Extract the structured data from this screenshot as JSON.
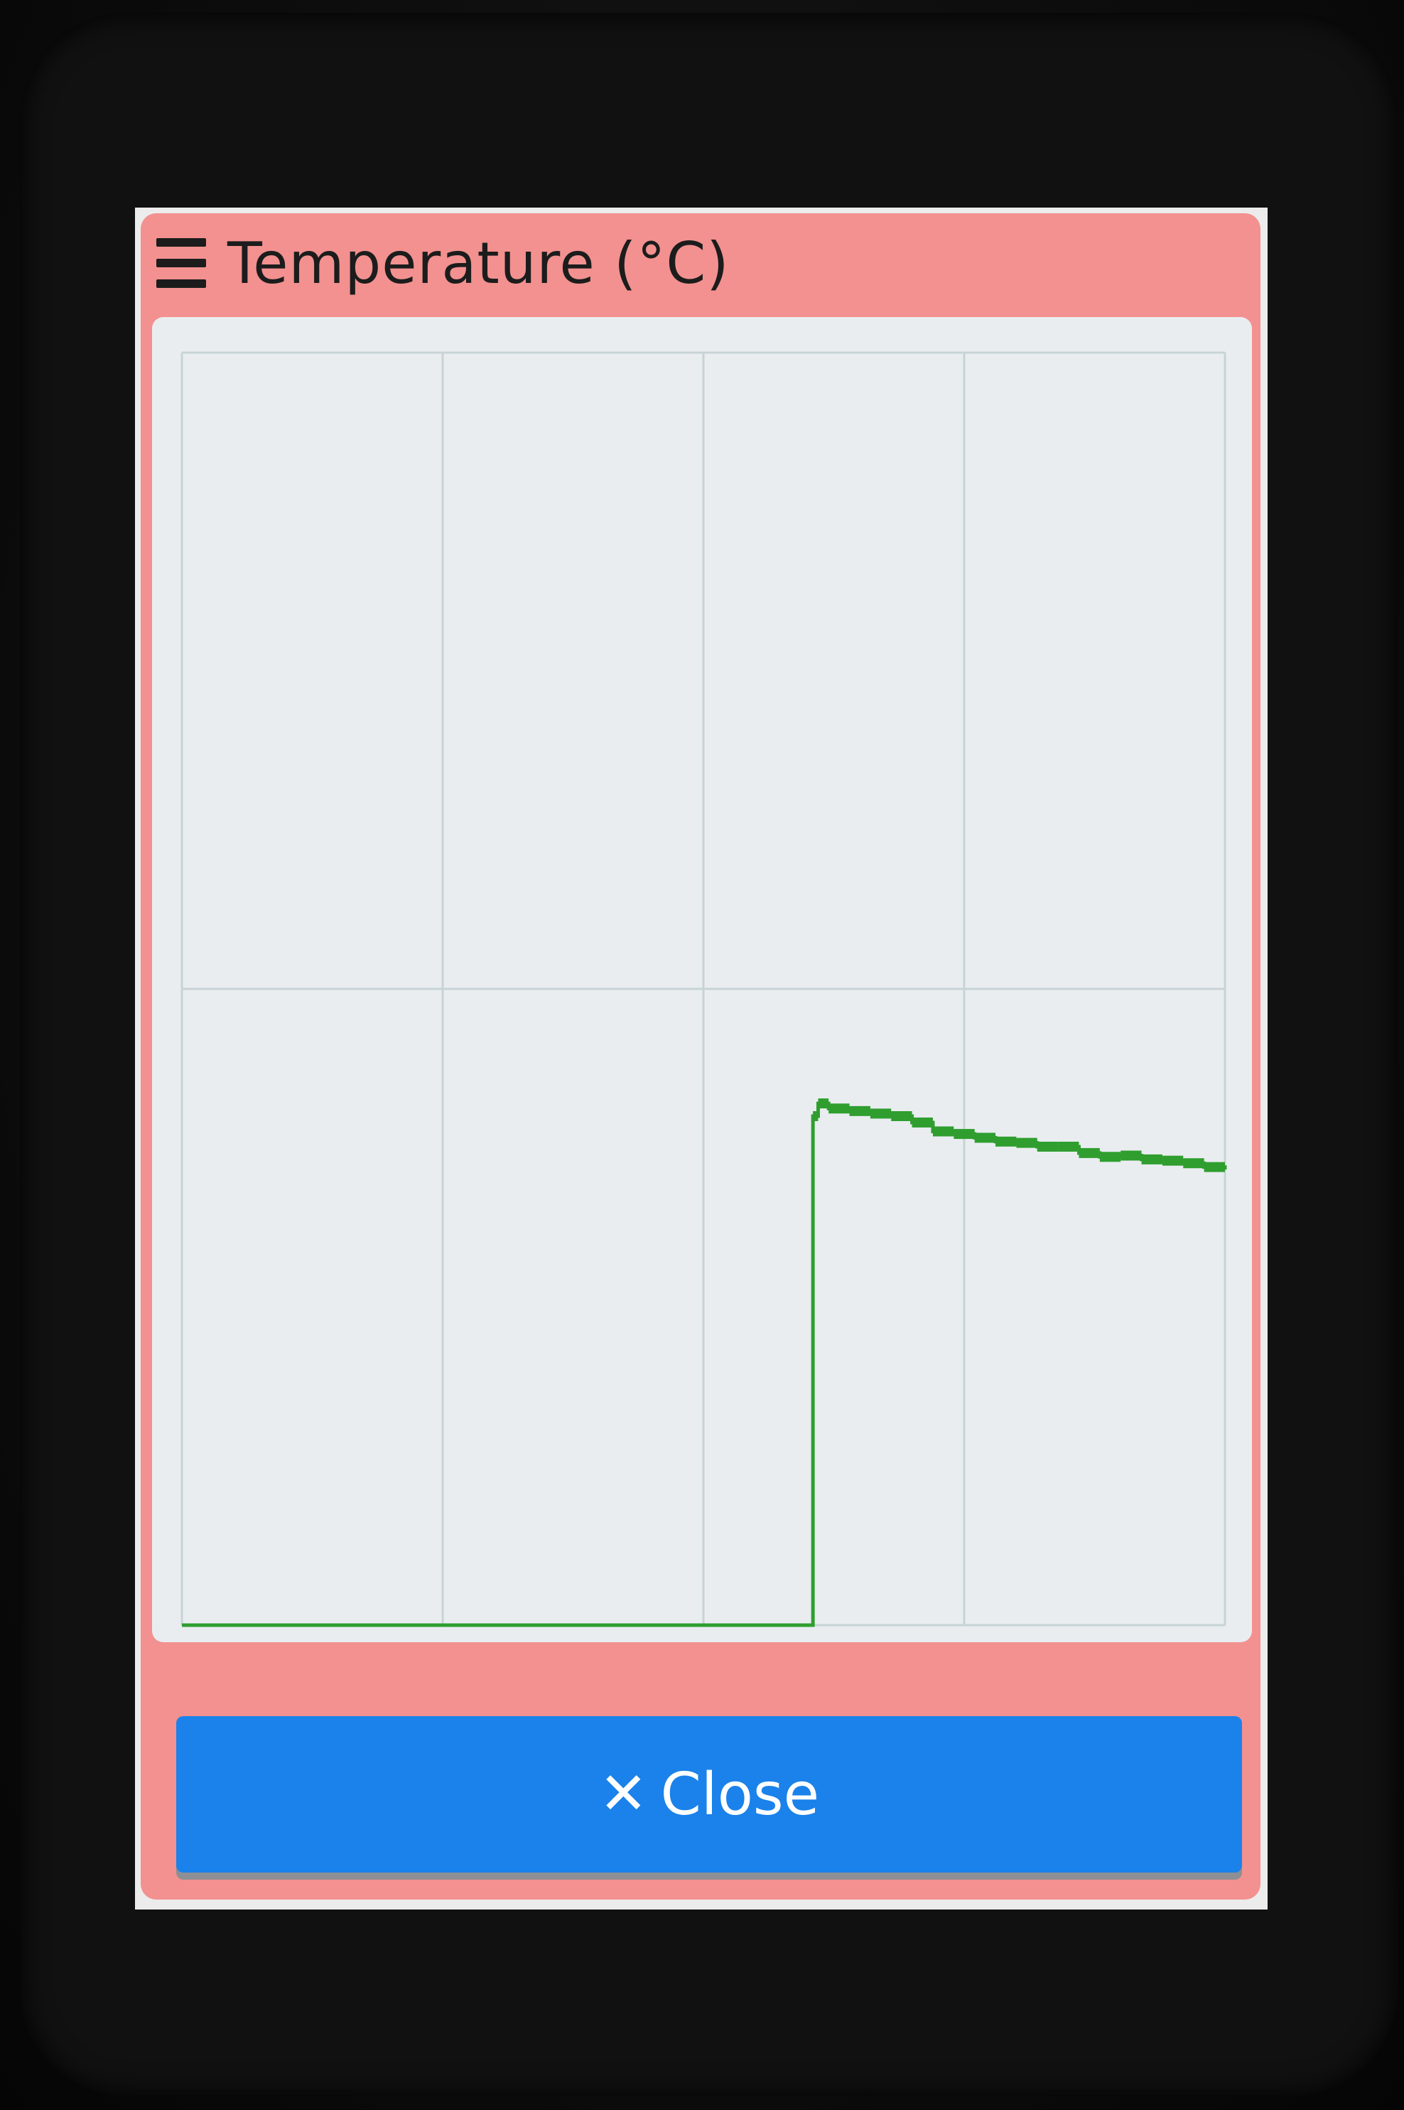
{
  "header": {
    "menu_icon": "hamburger-menu-icon",
    "title": "Temperature (°C)"
  },
  "colors": {
    "panel_background": "#f2918f",
    "chart_background": "#e9edf0",
    "series_color": "#2f9e2f",
    "button_color": "#1a82ea"
  },
  "chart_data": {
    "type": "line",
    "title": "Temperature (°C)",
    "xlabel": "",
    "ylabel": "",
    "grid": true,
    "xlim": [
      0,
      100
    ],
    "ylim": [
      0,
      100
    ],
    "series": [
      {
        "x": [
          0,
          2,
          4,
          6,
          8,
          10,
          12,
          14,
          16,
          18,
          20,
          22,
          24,
          26,
          28,
          30,
          32,
          34,
          36,
          38,
          40,
          42,
          44,
          46,
          48,
          50,
          52,
          54,
          56,
          58,
          60,
          60.5,
          61,
          62,
          64,
          66,
          68,
          70,
          72,
          74,
          76,
          78,
          80,
          82,
          84,
          86,
          88,
          90,
          92,
          94,
          96,
          98,
          100
        ],
        "values": [
          0,
          0,
          0,
          0,
          0,
          0,
          0,
          0,
          0,
          0,
          0,
          0,
          0,
          0,
          0,
          0,
          0,
          0,
          0,
          0,
          0,
          0,
          0,
          0,
          0,
          0,
          0,
          0,
          0,
          0,
          0,
          40,
          41,
          40.6,
          40.4,
          40.2,
          40,
          39.5,
          38.8,
          38.6,
          38.3,
          38,
          37.9,
          37.6,
          37.6,
          37.1,
          36.8,
          36.9,
          36.6,
          36.5,
          36.3,
          36,
          35.8
        ]
      }
    ]
  },
  "footer": {
    "close_icon": "close-x-icon",
    "close_label": "Close"
  }
}
